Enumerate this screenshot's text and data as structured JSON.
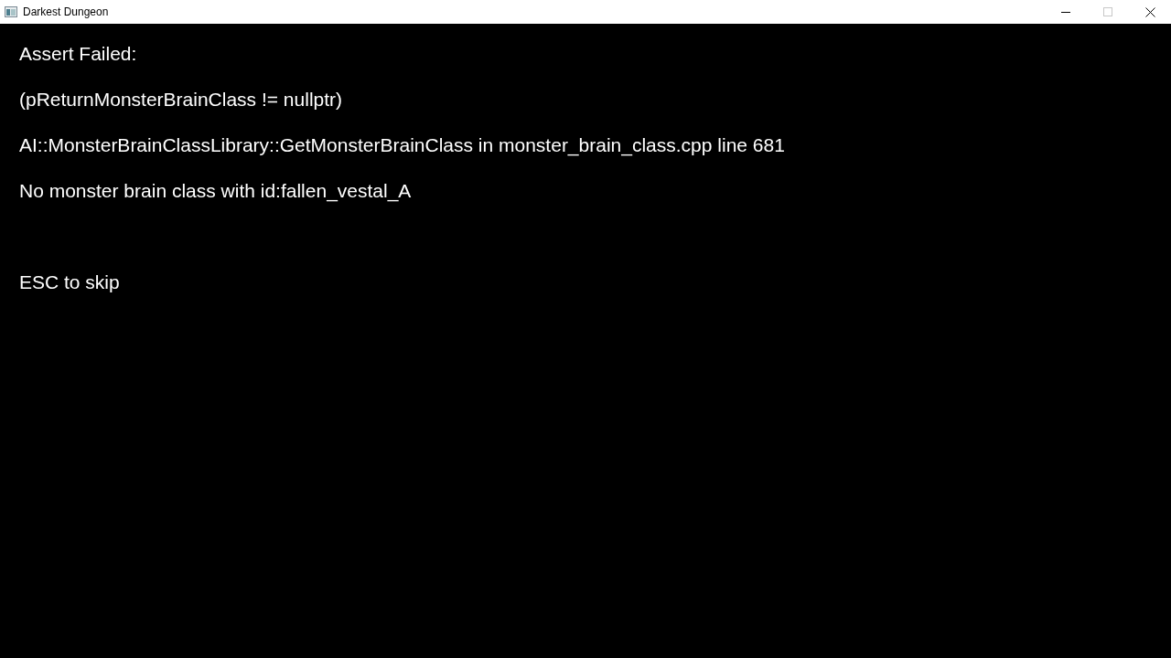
{
  "window": {
    "title": "Darkest Dungeon",
    "maximize_disabled": true
  },
  "message_lines": [
    "Assert Failed:",
    "(pReturnMonsterBrainClass != nullptr)",
    "AI::MonsterBrainClassLibrary::GetMonsterBrainClass in monster_brain_class.cpp line 681",
    "No monster brain class with id:fallen_vestal_A"
  ],
  "prompt": "ESC to skip"
}
